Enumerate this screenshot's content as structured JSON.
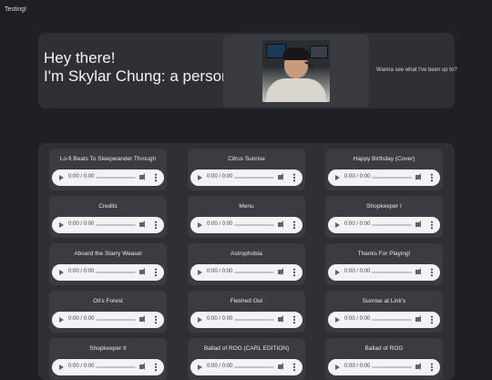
{
  "topbar": {
    "label": "Testing!"
  },
  "hero": {
    "line1": "Hey there!",
    "line2": "I'm Skylar Chung: a person!",
    "cta": "Wanna see what I've been up to?"
  },
  "player": {
    "time": "0:00 / 0:00"
  },
  "tracks": [
    {
      "title": "Lo-fi Beats To Sleepwander Through"
    },
    {
      "title": "Citrus Sunrise"
    },
    {
      "title": "Happy Birthday (Cover)"
    },
    {
      "title": "Credits"
    },
    {
      "title": "Menu"
    },
    {
      "title": "Shopkeeper I"
    },
    {
      "title": "Aboard the Starry Weasel"
    },
    {
      "title": "Astrophobia"
    },
    {
      "title": "Thanks For Playing!"
    },
    {
      "title": "Oli's Forest"
    },
    {
      "title": "Fleshed Out"
    },
    {
      "title": "Sunrise at Link's"
    },
    {
      "title": "Shopkeeper II"
    },
    {
      "title": "Ballad of ROG (CARL EDITION)"
    },
    {
      "title": "Ballad of ROG"
    }
  ]
}
